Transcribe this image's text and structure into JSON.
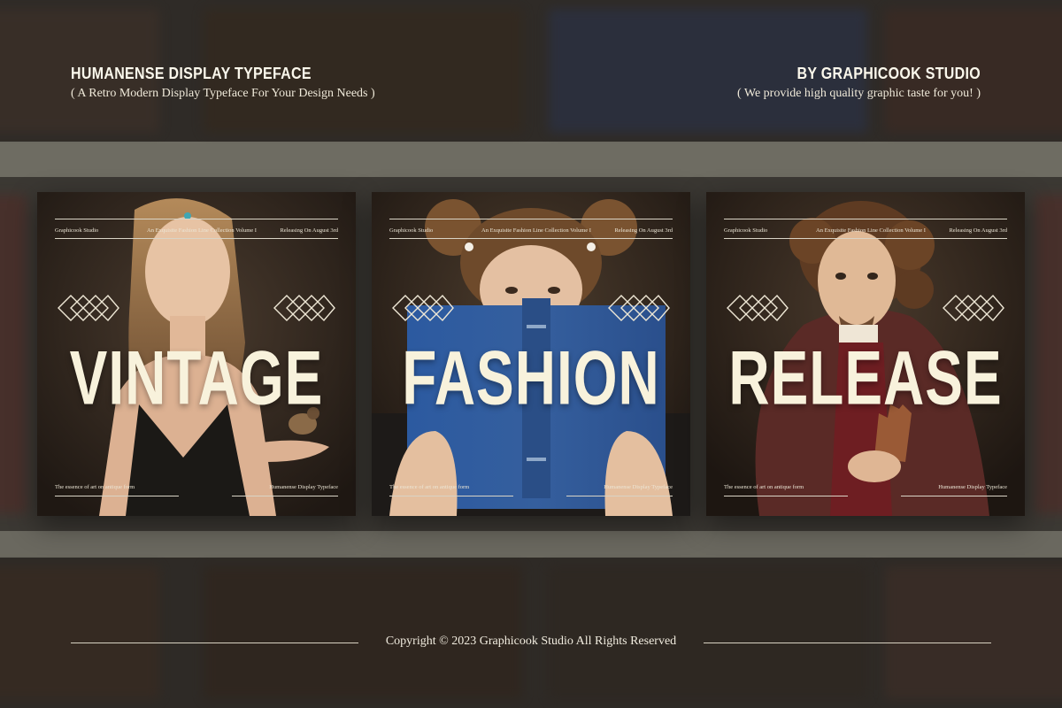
{
  "header": {
    "left_title": "HUMANENSE DISPLAY TYPEFACE",
    "left_subtitle": "( A Retro Modern Display Typeface For Your Design Needs )",
    "right_title": "BY GRAPHICOOK STUDIO",
    "right_subtitle": "( We provide high quality graphic taste for you! )"
  },
  "cards": [
    {
      "word": "VINTAGE",
      "meta_left": "Graphicook Studio",
      "meta_center": "An Exquisite Fashion Line Collection Volume I",
      "meta_right": "Releasing On August 3rd",
      "foot_left": "The essence of art on antique form",
      "foot_right": "Humanense Display Typeface"
    },
    {
      "word": "FASHION",
      "meta_left": "Graphicook Studio",
      "meta_center": "An Exquisite Fashion Line Collection Volume I",
      "meta_right": "Releasing On August 3rd",
      "foot_left": "The essence of art on antique form",
      "foot_right": "Humanense Display Typeface"
    },
    {
      "word": "RELEASE",
      "meta_left": "Graphicook Studio",
      "meta_center": "An Exquisite Fashion Line Collection Volume I",
      "meta_right": "Releasing On August 3rd",
      "foot_left": "The essence of art on antique form",
      "foot_right": "Humanense Display Typeface"
    }
  ],
  "footer": {
    "copyright": "Copyright © 2023 Graphicook Studio All Rights Reserved"
  },
  "colors": {
    "text": "#f8f2dc",
    "card_bg": "#2b231d",
    "book_blue": "#2f5fa6"
  }
}
